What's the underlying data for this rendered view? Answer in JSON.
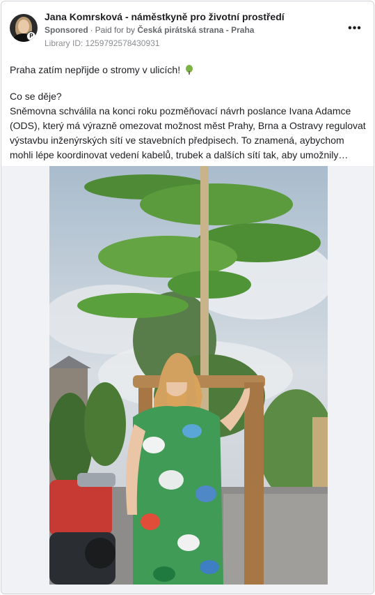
{
  "post": {
    "author": "Jana Komrsková - náměstkyně pro životní prostředí",
    "sponsored_label": "Sponsored",
    "separator": "·",
    "paid_for_prefix": "Paid for by",
    "paid_for_by": "Česká pirátská strana - Praha",
    "library_id": "Library ID: 1259792578430931",
    "more_icon": "more-horizontal-icon"
  },
  "content": {
    "headline": "Praha zatím nepřijde o stromy v ulicích!",
    "headline_emoji": "tree-icon",
    "question": "Co se děje?",
    "paragraph": "Sněmovna schválila na konci roku pozměňovací návrh poslance Ivana Adamce (ODS), který má výrazně omezovat možnost měst Prahy, Brna a Ostravy regulovat výstavbu inženýrských sítí ve stavebních předpisech. To znamená, aybychom mohli lépe koordinovat vedení kabelů, trubek a dalších sítí tak, aby umožnily…"
  },
  "media": {
    "type": "photo",
    "subject": "woman-beside-young-tree-photo"
  },
  "colors": {
    "text": "#1c1e21",
    "secondary": "#65676b",
    "media_background": "#f0f2f5"
  }
}
